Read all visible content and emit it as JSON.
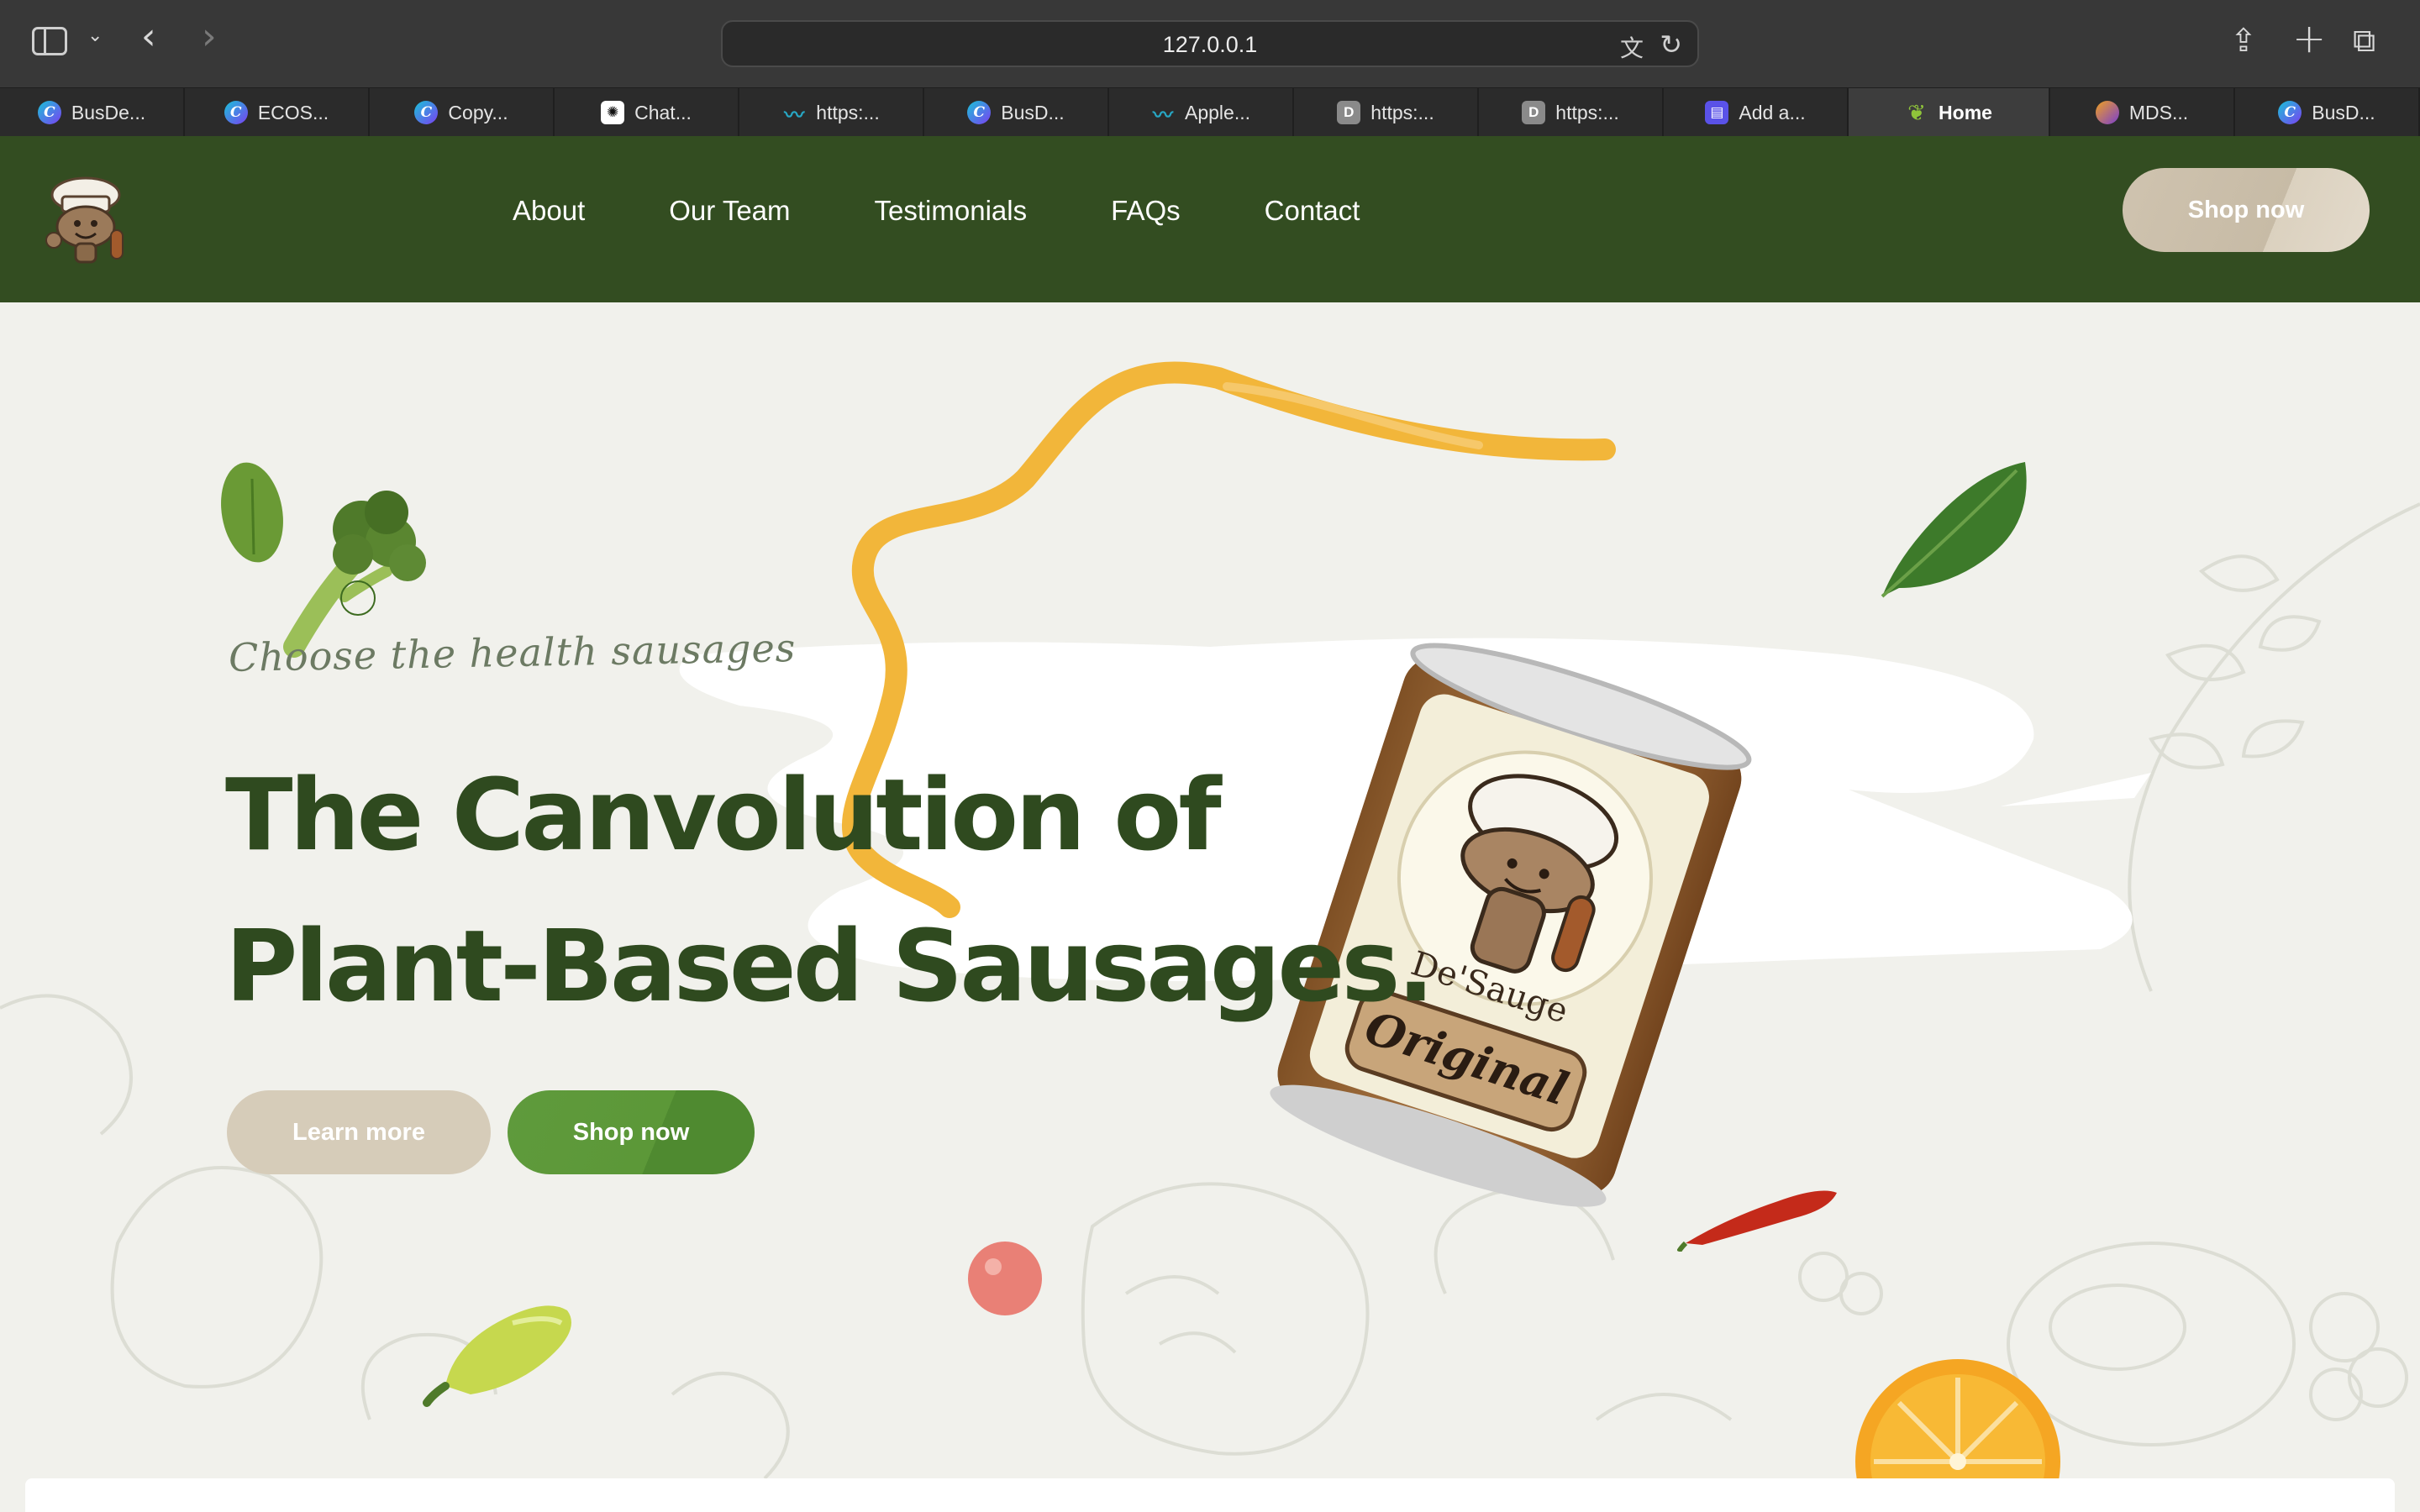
{
  "browser": {
    "address": "127.0.0.1",
    "icons": {
      "sidebar": "sidebar-toggle-icon",
      "back": "chevron-left-icon",
      "forward": "chevron-right-icon",
      "translate": "translate-icon",
      "reload": "reload-icon",
      "share": "share-icon",
      "new_tab": "plus-icon",
      "tab_overview": "tab-overview-icon"
    },
    "tabs": [
      {
        "label": "BusDe...",
        "favicon": "canva"
      },
      {
        "label": "ECOS...",
        "favicon": "canva"
      },
      {
        "label": "Copy...",
        "favicon": "canva"
      },
      {
        "label": "Chat...",
        "favicon": "openai"
      },
      {
        "label": "https:...",
        "favicon": "feather"
      },
      {
        "label": "BusD...",
        "favicon": "canva"
      },
      {
        "label": "Apple...",
        "favicon": "feather"
      },
      {
        "label": "https:...",
        "favicon": "d"
      },
      {
        "label": "https:...",
        "favicon": "d"
      },
      {
        "label": "Add a...",
        "favicon": "add"
      },
      {
        "label": "Home",
        "favicon": "leaf",
        "active": true
      },
      {
        "label": "MDS...",
        "favicon": "mds"
      },
      {
        "label": "BusD...",
        "favicon": "canva"
      }
    ]
  },
  "site": {
    "logo_text": "De'Sauge",
    "nav": [
      "About",
      "Our Team",
      "Testimonials",
      "FAQs",
      "Contact"
    ],
    "header_cta": "Shop now",
    "hero": {
      "tagline": "Choose the health sausages",
      "headline_line1": "The Canvolution of",
      "headline_line2": "Plant-Based Sausages.",
      "learn_more": "Learn more",
      "shop_now": "Shop now",
      "can_brand": "De'Sauge",
      "can_label": "Original"
    }
  },
  "colors": {
    "header_green": "#334d21",
    "headline_green": "#2f4a1f",
    "shop_green": "#5c9838",
    "beige": "#d6ccb9",
    "hero_bg": "#f1f1ec"
  }
}
